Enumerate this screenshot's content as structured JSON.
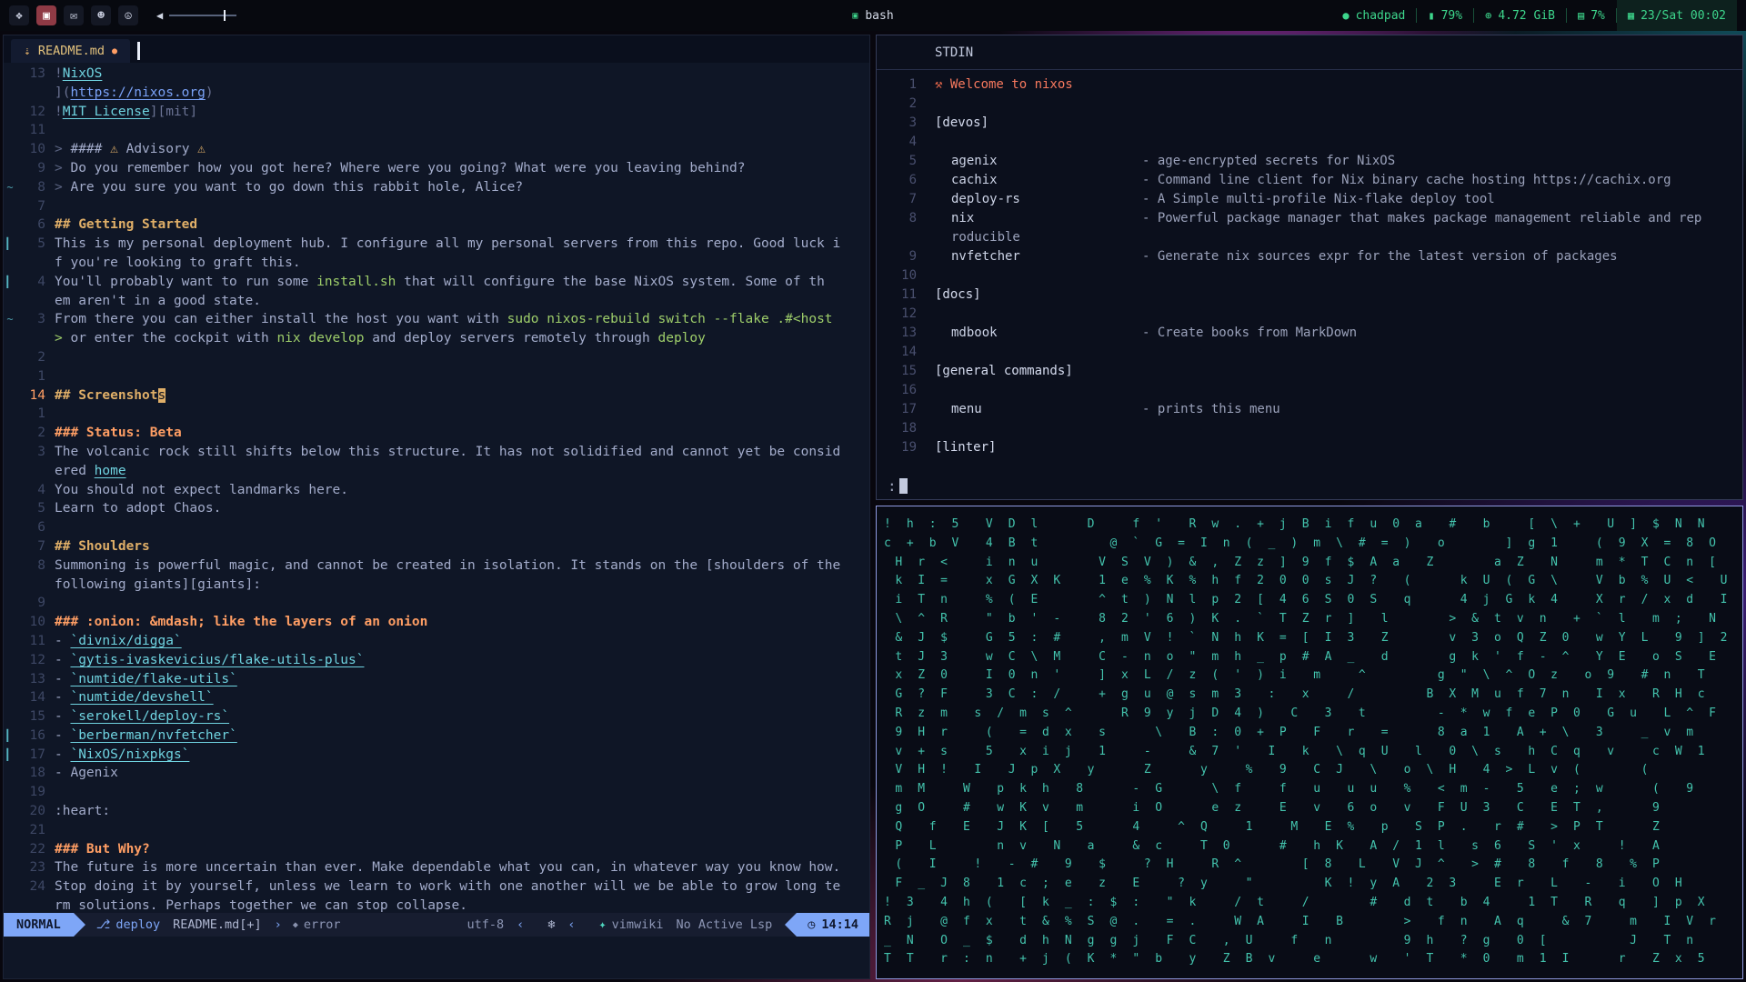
{
  "theme": {
    "accent_blue": "#7ea6f7",
    "accent_green": "#3dd68c",
    "heading_yellow": "#e0af68",
    "heading_orange": "#ff9e64",
    "link_cyan": "#6fd3e0",
    "code_green": "#9ece6a",
    "glyph_teal": "#43c3ad",
    "active_tag_red": "#8f3a45"
  },
  "topbar": {
    "workspaces": [
      {
        "glyph": "❖",
        "active": false,
        "name": "workspace-launcher"
      },
      {
        "glyph": "▣",
        "active": true,
        "name": "workspace-terminal"
      },
      {
        "glyph": "✉",
        "active": false,
        "name": "workspace-chat"
      },
      {
        "glyph": "☻",
        "active": false,
        "name": "workspace-ghost"
      },
      {
        "glyph": "☮",
        "active": false,
        "name": "workspace-misc"
      }
    ],
    "volume": {
      "icon": "◀"
    },
    "center": {
      "icon": "▣",
      "title": "bash"
    },
    "right": [
      {
        "icon": "●",
        "label": "chadpad",
        "name": "status-user"
      },
      {
        "icon": "▮",
        "label": "79%",
        "name": "status-battery"
      },
      {
        "icon": "⊕",
        "label": "4.72 GiB",
        "name": "status-memory"
      },
      {
        "icon": "▤",
        "label": "7%",
        "name": "status-disk"
      },
      {
        "icon": "▦",
        "label": "23/Sat 00:02",
        "name": "status-clock",
        "highlight": true
      }
    ]
  },
  "editor": {
    "tab": {
      "icon": "⇣",
      "title": "README.md",
      "modified": "●"
    },
    "statusline": {
      "mode": "NORMAL",
      "branch_icon": "⎇",
      "git_branch": "deploy",
      "filename": "README.md[+]",
      "chevron": "›",
      "error_icon": "◆",
      "error_label": "error",
      "encoding": "utf-8",
      "sep_left": "‹",
      "sep_left2": "‹",
      "os_icon": "❄",
      "filetype_icon": "✦",
      "filetype": "vimwiki",
      "lsp": "No Active Lsp",
      "clock_icon": "◷",
      "time": "14:14"
    },
    "lines": [
      {
        "n": "13",
        "seg": [
          {
            "t": "!",
            "c": "punct"
          },
          {
            "t": "NixOS",
            "c": "link"
          }
        ]
      },
      {
        "n": "",
        "seg": [
          {
            "t": "](",
            "c": "punct"
          },
          {
            "t": "https://nixos.org",
            "c": "url"
          },
          {
            "t": ")",
            "c": "punct"
          }
        ]
      },
      {
        "n": "12",
        "seg": [
          {
            "t": "!",
            "c": "punct"
          },
          {
            "t": "MIT License",
            "c": "link"
          },
          {
            "t": "][mit]",
            "c": "punct"
          }
        ]
      },
      {
        "n": "11",
        "seg": []
      },
      {
        "n": "10",
        "seg": [
          {
            "t": "> ",
            "c": "quote"
          },
          {
            "t": "#### ",
            "c": "text"
          },
          {
            "t": "⚠ ",
            "c": "warn"
          },
          {
            "t": "Advisory",
            "c": "text"
          },
          {
            "t": " ⚠",
            "c": "warn"
          }
        ]
      },
      {
        "n": "9",
        "seg": [
          {
            "t": "> ",
            "c": "quote"
          },
          {
            "t": "Do you remember how you got here? Where were you going? What were you leaving behind?",
            "c": "text"
          }
        ]
      },
      {
        "n": "8",
        "sign": "~",
        "seg": [
          {
            "t": "> ",
            "c": "quote"
          },
          {
            "t": "Are you sure you want to go down this rabbit hole, Alice?",
            "c": "text"
          }
        ]
      },
      {
        "n": "7",
        "seg": []
      },
      {
        "n": "6",
        "seg": [
          {
            "t": "## Getting Started",
            "c": "h2"
          }
        ]
      },
      {
        "n": "5",
        "sign": "|",
        "seg": [
          {
            "t": "This is my personal deployment hub. I configure all my personal servers from this repo. Good luck i",
            "c": "text"
          }
        ]
      },
      {
        "n": "",
        "seg": [
          {
            "t": "f you're looking to graft this.",
            "c": "text"
          }
        ]
      },
      {
        "n": "4",
        "sign": "|",
        "seg": [
          {
            "t": "You'll probably want to run some ",
            "c": "text"
          },
          {
            "t": "install.sh",
            "c": "code"
          },
          {
            "t": " that will configure the base NixOS system. Some of th",
            "c": "text"
          }
        ]
      },
      {
        "n": "",
        "seg": [
          {
            "t": "em aren't in a good state.",
            "c": "text"
          }
        ]
      },
      {
        "n": "3",
        "sign": "~",
        "seg": [
          {
            "t": "From there you can either install the host you want with ",
            "c": "text"
          },
          {
            "t": "sudo nixos-rebuild switch --flake .#<host",
            "c": "code"
          }
        ]
      },
      {
        "n": "",
        "seg": [
          {
            "t": "> ",
            "c": "code"
          },
          {
            "t": "or enter the cockpit with ",
            "c": "text"
          },
          {
            "t": "nix develop",
            "c": "code"
          },
          {
            "t": " and deploy servers remotely through ",
            "c": "text"
          },
          {
            "t": "deploy",
            "c": "code"
          }
        ]
      },
      {
        "n": "2",
        "seg": []
      },
      {
        "n": "1",
        "seg": []
      },
      {
        "n": "14",
        "cur": true,
        "seg": [
          {
            "t": "## Screenshot",
            "c": "h2"
          },
          {
            "t": "s",
            "c": "cursor"
          }
        ]
      },
      {
        "n": "1",
        "seg": []
      },
      {
        "n": "2",
        "seg": [
          {
            "t": "### Status: Beta",
            "c": "h3"
          }
        ]
      },
      {
        "n": "3",
        "seg": [
          {
            "t": "The volcanic rock still shifts below this structure. It has not solidified and cannot yet be consid",
            "c": "text"
          }
        ]
      },
      {
        "n": "",
        "seg": [
          {
            "t": "ered ",
            "c": "text"
          },
          {
            "t": "home",
            "c": "link"
          }
        ]
      },
      {
        "n": "4",
        "seg": [
          {
            "t": "You should not expect landmarks here.",
            "c": "text"
          }
        ]
      },
      {
        "n": "5",
        "seg": [
          {
            "t": "Learn to adopt Chaos.",
            "c": "text"
          }
        ]
      },
      {
        "n": "6",
        "seg": []
      },
      {
        "n": "7",
        "seg": [
          {
            "t": "## Shoulders",
            "c": "h2"
          }
        ]
      },
      {
        "n": "8",
        "seg": [
          {
            "t": "Summoning is powerful magic, and cannot be created in isolation. It stands on the [shoulders of the",
            "c": "text"
          }
        ]
      },
      {
        "n": "",
        "seg": [
          {
            "t": "following giants][giants]:",
            "c": "text"
          }
        ]
      },
      {
        "n": "9",
        "seg": []
      },
      {
        "n": "10",
        "seg": [
          {
            "t": "### :onion: &mdash; like the layers of an onion",
            "c": "h3"
          }
        ]
      },
      {
        "n": "11",
        "seg": [
          {
            "t": "- ",
            "c": "text"
          },
          {
            "t": "`divnix/digga`",
            "c": "codelink"
          }
        ]
      },
      {
        "n": "12",
        "seg": [
          {
            "t": "- ",
            "c": "text"
          },
          {
            "t": "`gytis-ivaskevicius/flake-utils-plus`",
            "c": "codelink"
          }
        ]
      },
      {
        "n": "13",
        "seg": [
          {
            "t": "- ",
            "c": "text"
          },
          {
            "t": "`numtide/flake-utils`",
            "c": "codelink"
          }
        ]
      },
      {
        "n": "14",
        "seg": [
          {
            "t": "- ",
            "c": "text"
          },
          {
            "t": "`numtide/devshell`",
            "c": "codelink"
          }
        ]
      },
      {
        "n": "15",
        "seg": [
          {
            "t": "- ",
            "c": "text"
          },
          {
            "t": "`serokell/deploy-rs`",
            "c": "codelink"
          }
        ]
      },
      {
        "n": "16",
        "sign": "|",
        "seg": [
          {
            "t": "- ",
            "c": "text"
          },
          {
            "t": "`berberman/nvfetcher`",
            "c": "codelink"
          }
        ]
      },
      {
        "n": "17",
        "sign": "|",
        "seg": [
          {
            "t": "- ",
            "c": "text"
          },
          {
            "t": "`NixOS/nixpkgs`",
            "c": "codelink"
          }
        ]
      },
      {
        "n": "18",
        "seg": [
          {
            "t": "- Agenix",
            "c": "text"
          }
        ]
      },
      {
        "n": "19",
        "seg": []
      },
      {
        "n": "20",
        "seg": [
          {
            "t": ":heart:",
            "c": "text"
          }
        ]
      },
      {
        "n": "21",
        "seg": []
      },
      {
        "n": "22",
        "seg": [
          {
            "t": "### But Why?",
            "c": "h3"
          }
        ]
      },
      {
        "n": "23",
        "seg": [
          {
            "t": "The future is more uncertain than ever. Make dependable what you can, in whatever way you know how.",
            "c": "text"
          }
        ]
      },
      {
        "n": "24",
        "seg": [
          {
            "t": "Stop doing it by yourself, unless we learn to work with one another will we be able to grow long te",
            "c": "text"
          }
        ]
      },
      {
        "n": "",
        "seg": [
          {
            "t": "rm solutions. Perhaps together we can stop collapse.",
            "c": "text"
          }
        ]
      }
    ]
  },
  "terminal": {
    "title": "STDIN",
    "prompt": ":",
    "lines": [
      {
        "n": "1",
        "icon": "⚒",
        "text": "Welcome to nixos"
      },
      {
        "n": "2"
      },
      {
        "n": "3",
        "text": "[devos]",
        "c": "head"
      },
      {
        "n": "4"
      },
      {
        "n": "5",
        "name": "agenix",
        "desc": "- age-encrypted secrets for NixOS"
      },
      {
        "n": "6",
        "name": "cachix",
        "desc": "- Command line client for Nix binary cache hosting https://cachix.org"
      },
      {
        "n": "7",
        "name": "deploy-rs",
        "desc": "- A Simple multi-profile Nix-flake deploy tool"
      },
      {
        "n": "8",
        "name": "nix",
        "desc": "- Powerful package manager that makes package management reliable and rep"
      },
      {
        "n": "",
        "text": "roducible",
        "c": "wrap"
      },
      {
        "n": "9",
        "name": "nvfetcher",
        "desc": "- Generate nix sources expr for the latest version of packages"
      },
      {
        "n": "10"
      },
      {
        "n": "11",
        "text": "[docs]",
        "c": "head"
      },
      {
        "n": "12"
      },
      {
        "n": "13",
        "name": "mdbook",
        "desc": "- Create books from MarkDown"
      },
      {
        "n": "14"
      },
      {
        "n": "15",
        "text": "[general commands]",
        "c": "head"
      },
      {
        "n": "16"
      },
      {
        "n": "17",
        "name": "menu",
        "desc": "- prints this menu"
      },
      {
        "n": "18"
      },
      {
        "n": "19",
        "text": "[linter]",
        "c": "head"
      }
    ]
  },
  "glyph_grid": {
    "rows": [
      "! h : 5  V D l    D   f '  R w . + j B i f u 0 a  #  b   [ \\ +  U ] $ N N",
      "c + b V  4 B t      @ ` G = I n ( _ ) m \\ # = )  o     ] g 1   ( 9 X = 8 O",
      " H r <   i n u     V S V ) & , Z z ] 9 f $ A a  Z     a Z  N   m * T C n [",
      " k I =   x G X K   1 e % K % h f 2 0 0 s J ?  (    k U ( G \\   V b % U <  U",
      " i T n   % ( E     ^ t ) N l p 2 [ 4 6 S 0 S  q    4 j G k 4   X r / x d  I",
      " \\ ^ R   \" b ' -   8 2 ' 6 ) K . ` T Z r ]  l     > & t v n  + ` l  m ;  N",
      " & J $   G 5 : #   , m V ! ` N h K = [ I 3  Z     v 3 o Q Z 0  w Y L  9 ] 2",
      " t J 3   w C \\ M   C - n o \" m h _ p # A _  d     g k ' f - ^  Y E  o S  E",
      " x Z 0   I 0 n '   ] x L / z ( ' ) i  m   ^      g \" \\ ^ O z  o 9  # n  T",
      " G ? F   3 C : /   + g u @ s m 3  :  x   /      B X M u f 7 n  I x  R H c",
      " R z m  s / m s ^    R 9 y j D 4 )  C  3  t      - * w f e P 0  G u  L ^ F",
      " 9 H r   (  = d x  s    \\  B : 0 + P  F  r  =    8 a 1  A + \\  3   _ v m",
      " v + s   5  x i j  1   -   & 7 '  I  k  \\ q U  l  0 \\ s  h C q  v   c W 1",
      " V H !  I  J p X  y    Z    y   %  9  C J  \\  o \\ H  4 > L v (     (",
      " m M   W  p k h  8    - G    \\ f   f  u  u u  %  < m -  5  e ; w    (  9",
      " g O   #  w K v  m    i O    e z   E  v  6 o  v  F U 3  C  E T ,    9",
      " Q  f  E  J K [  5    4   ^ Q   1   M  E %  p  S P .  r #  > P T    Z",
      " P  L     n v  N  a   & c   T 0    #  h K  A / 1 l  s 6  S ' x   !  A",
      " (  I   !  - #  9  $   ? H   R ^     [ 8  L  V J ^  > #  8  f  8  % P",
      " F _ J 8  1 c ; e  z  E   ? y   \"      K ! y A  2 3   E r  L  -  i  O H",
      "! 3  4 h (  [ k _ : $ :  \" k   / t   /     #  d t  b 4   1 T  R  q  ] p X",
      "R j  @ f x  t & % S @ .  = .   W A   I  B     >  f n  A q   & 7   m  I V r",
      "_ N  O _ $  d h N g g j  F C  , U   f  n      9 h  ? g  0 [       J  T n",
      "T T  r : n  + j ( K * \" b  y  Z B v   e    w  ' T  * 0  m 1 I    r  Z x 5"
    ]
  }
}
